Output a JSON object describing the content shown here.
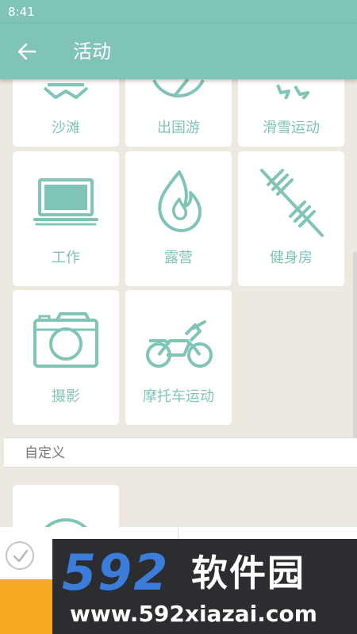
{
  "status_bar": {
    "time": "8:41"
  },
  "app_bar": {
    "title": "活动",
    "back_icon": "arrow-left-icon"
  },
  "tiles": [
    {
      "label": "沙滩",
      "icon": "beach-icon"
    },
    {
      "label": "出国游",
      "icon": "globe-icon"
    },
    {
      "label": "滑雪运动",
      "icon": "ski-icon"
    },
    {
      "label": "工作",
      "icon": "laptop-icon"
    },
    {
      "label": "露营",
      "icon": "campfire-icon"
    },
    {
      "label": "健身房",
      "icon": "dumbbell-icon"
    },
    {
      "label": "摄影",
      "icon": "camera-icon"
    },
    {
      "label": "摩托车运动",
      "icon": "motorcycle-icon"
    }
  ],
  "custom_section": {
    "title": "自定义",
    "add_icon": "add-circle-icon"
  },
  "check_icon": "checkmark-icon",
  "watermark": {
    "digits": "592",
    "name": "软件园",
    "url": "www.592xiazai.com"
  },
  "colors": {
    "primary": "#80c4b8",
    "background": "#ede9e1",
    "accent": "#f6a820"
  }
}
